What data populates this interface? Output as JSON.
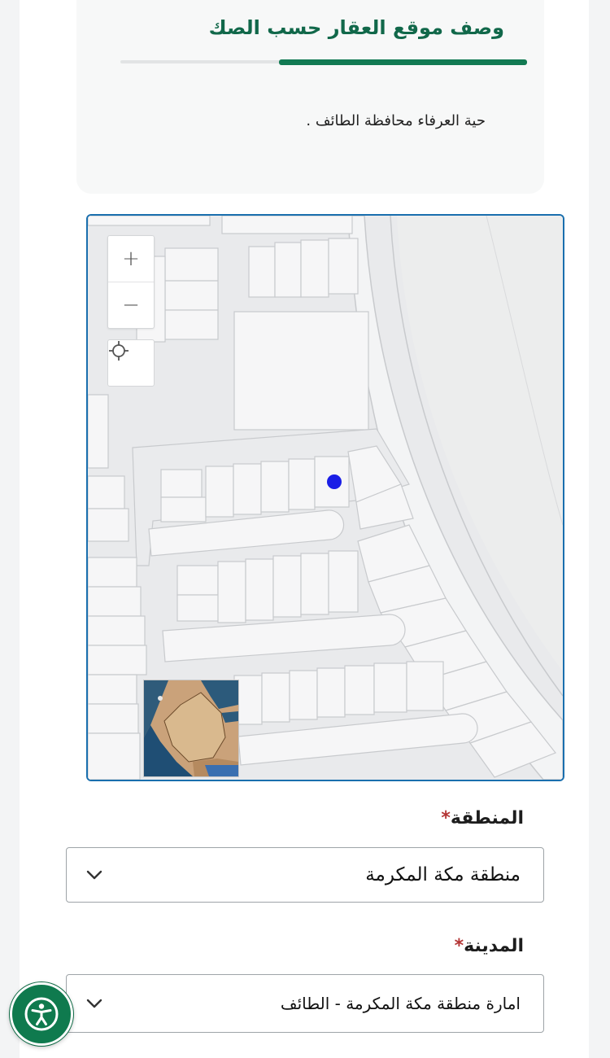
{
  "header": {
    "section_title": "وصف موقع العقار حسب الصك",
    "description": "حية العرفاء محافظة الطائف ."
  },
  "map": {
    "zoom_in_label": "+",
    "zoom_out_label": "−",
    "icons": [
      "zoom-in-icon",
      "zoom-out-icon",
      "locate-icon",
      "location-marker"
    ],
    "marker_color": "#1a1ee6"
  },
  "form": {
    "region": {
      "label": "المنطقة",
      "required_mark": "*",
      "selected_value": "منطقة مكة المكرمة"
    },
    "city": {
      "label": "المدينة",
      "required_mark": "*",
      "selected_value": "امارة منطقة مكة المكرمة - الطائف"
    }
  },
  "colors": {
    "brand_green": "#127a53",
    "map_border": "#1a6fae",
    "required": "#b33434"
  }
}
